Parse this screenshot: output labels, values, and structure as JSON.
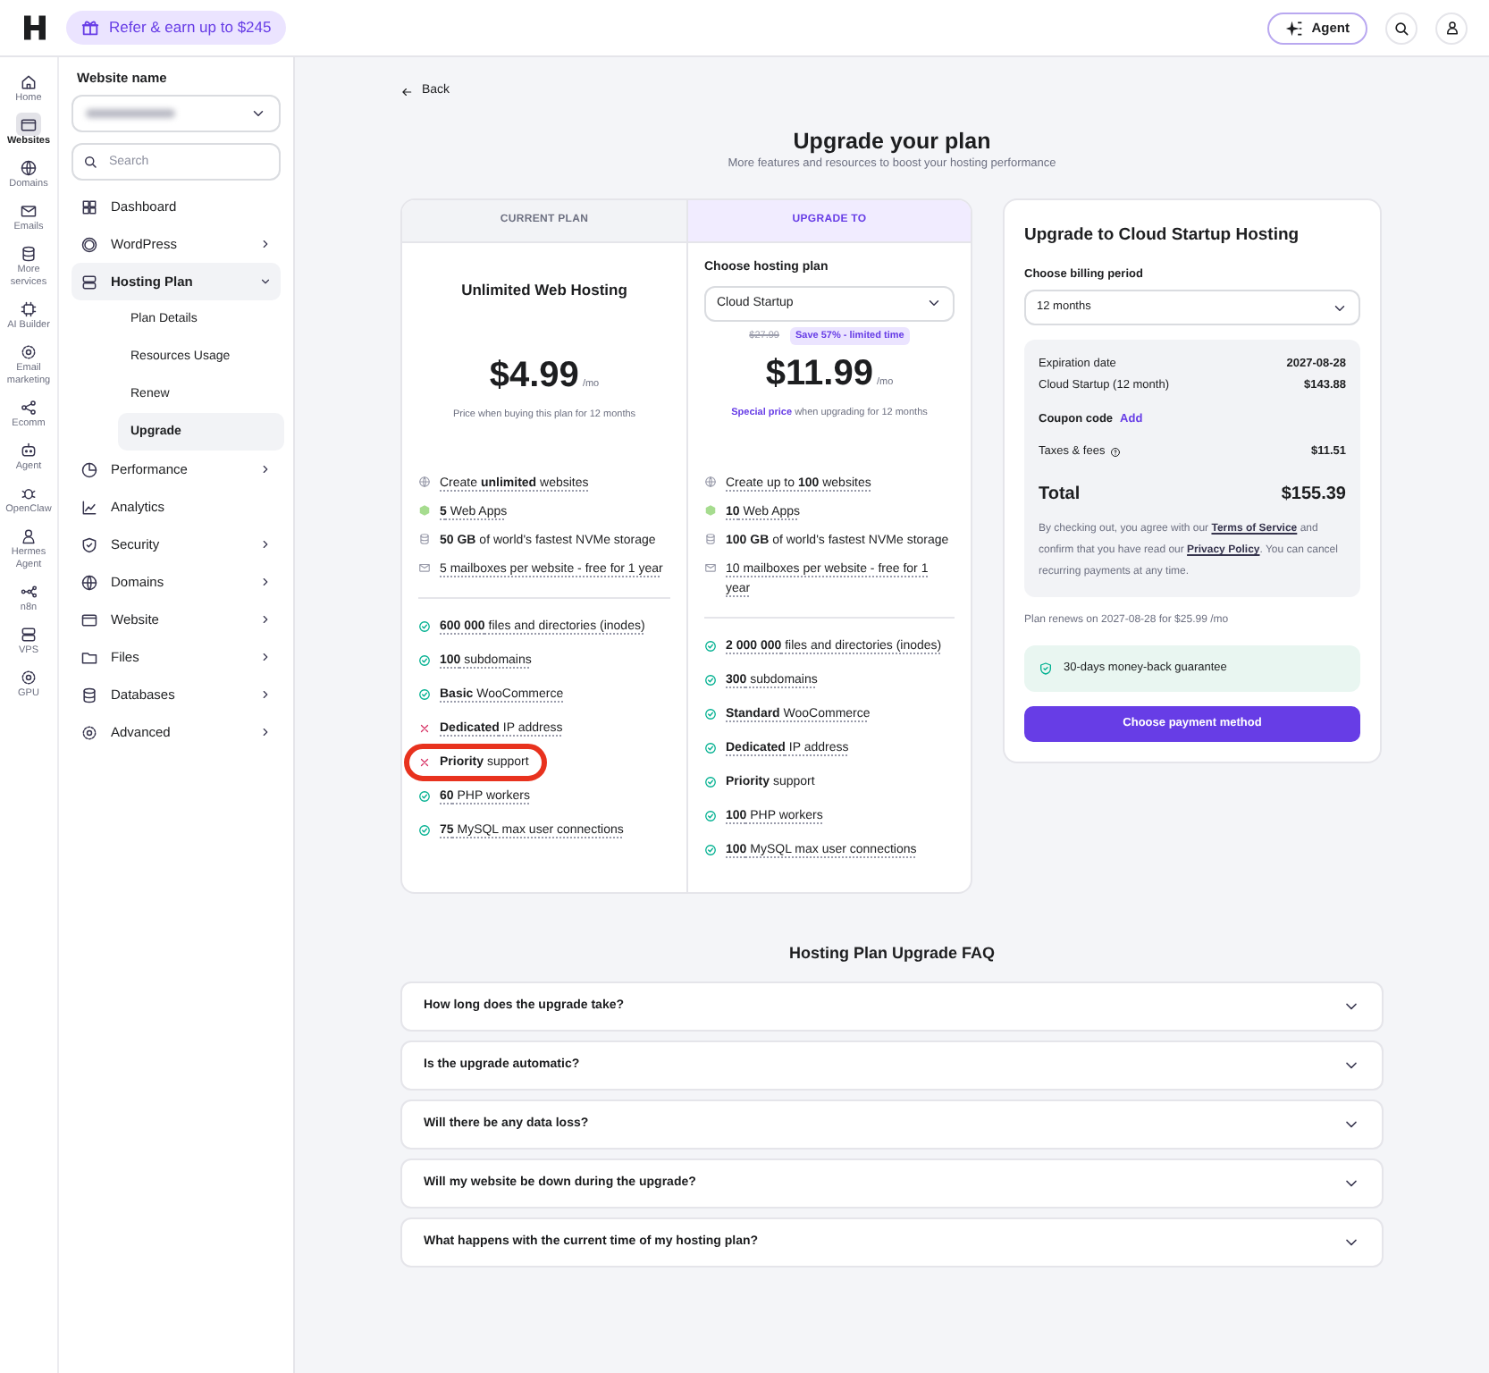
{
  "top_bar": {
    "promo": "Refer & earn up to $245",
    "agent_button": "Agent"
  },
  "rail": [
    {
      "label": "Home",
      "selected": false
    },
    {
      "label": "Websites",
      "selected": true
    },
    {
      "label": "Domains",
      "selected": false
    },
    {
      "label": "Emails",
      "selected": false
    },
    {
      "label": "More services",
      "selected": false
    },
    {
      "label": "AI Builder",
      "selected": false
    },
    {
      "label": "Email marketing",
      "selected": false
    },
    {
      "label": "Ecomm",
      "selected": false
    },
    {
      "label": "Agent",
      "selected": false
    },
    {
      "label": "OpenClaw",
      "selected": false
    },
    {
      "label": "Hermes Agent",
      "selected": false
    },
    {
      "label": "n8n",
      "selected": false
    },
    {
      "label": "VPS",
      "selected": false
    },
    {
      "label": "GPU",
      "selected": false
    }
  ],
  "nav": {
    "website_label": "Website name",
    "search_placeholder": "Search",
    "items": [
      {
        "label": "Dashboard",
        "selected": false
      },
      {
        "label": "WordPress",
        "selected": false,
        "expanded": false
      },
      {
        "label": "Hosting Plan",
        "selected": true,
        "expanded": true,
        "children": [
          {
            "label": "Plan Details",
            "selected": false
          },
          {
            "label": "Resources Usage",
            "selected": false
          },
          {
            "label": "Renew",
            "selected": false
          },
          {
            "label": "Upgrade",
            "selected": true
          }
        ]
      },
      {
        "label": "Performance",
        "selected": false,
        "expanded": false
      },
      {
        "label": "Analytics",
        "selected": false
      },
      {
        "label": "Security",
        "selected": false,
        "expanded": false
      },
      {
        "label": "Domains",
        "selected": false,
        "expanded": false
      },
      {
        "label": "Website",
        "selected": false,
        "expanded": false
      },
      {
        "label": "Files",
        "selected": false,
        "expanded": false
      },
      {
        "label": "Databases",
        "selected": false,
        "expanded": false
      },
      {
        "label": "Advanced",
        "selected": false,
        "expanded": false
      }
    ]
  },
  "back": "Back",
  "title": "Upgrade your plan",
  "subtitle": "More features and resources to boost your hosting performance",
  "current": {
    "header": "CURRENT PLAN",
    "name": "Unlimited Web Hosting",
    "price": "$4.99",
    "per": "/mo",
    "note": "Price when buying this plan for 12 months",
    "features": [
      {
        "kind": "globe",
        "text": "Create **unlimited** websites",
        "underlined": true
      },
      {
        "kind": "apps",
        "text": "**5** Web Apps",
        "underlined": true
      },
      {
        "kind": "storage",
        "text": "**50 GB** of world's fastest NVMe storage",
        "underlined": false
      },
      {
        "kind": "mail",
        "text": "5 mailboxes per website - free for 1 year",
        "underlined": true
      }
    ],
    "limits": [
      {
        "included": true,
        "text": "**600 000** files and directories (inodes)",
        "underlined": true,
        "highlighted": false
      },
      {
        "included": true,
        "text": "**100** subdomains",
        "underlined": true,
        "highlighted": false
      },
      {
        "included": true,
        "text": "**Basic** WooCommerce",
        "underlined": true,
        "highlighted": false
      },
      {
        "included": false,
        "text": "**Dedicated** IP address",
        "underlined": true,
        "highlighted": false
      },
      {
        "included": false,
        "text": "**Priority** support",
        "underlined": false,
        "highlighted": true
      },
      {
        "included": true,
        "text": "**60** PHP workers",
        "underlined": true,
        "highlighted": false
      },
      {
        "included": true,
        "text": "**75** MySQL max user connections",
        "underlined": true,
        "highlighted": false
      }
    ]
  },
  "upgrade": {
    "header": "UPGRADE TO",
    "select_label": "Choose hosting plan",
    "select_value": "Cloud Startup",
    "old_price": "$27.99",
    "discount": "Save 57% - limited time",
    "price": "$11.99",
    "per": "/mo",
    "note_highlight": "Special price",
    "note": "when upgrading for 12 months",
    "features": [
      {
        "kind": "globe",
        "text": "Create up to **100** websites",
        "underlined": true
      },
      {
        "kind": "apps",
        "text": "**10** Web Apps",
        "underlined": true
      },
      {
        "kind": "storage",
        "text": "**100 GB** of world's fastest NVMe storage",
        "underlined": false
      },
      {
        "kind": "mail",
        "text": "10 mailboxes per website - free for 1 year",
        "underlined": true
      }
    ],
    "limits": [
      {
        "included": true,
        "text": "**2 000 000** files and directories (inodes)",
        "underlined": true,
        "highlighted": false
      },
      {
        "included": true,
        "text": "**300** subdomains",
        "underlined": true,
        "highlighted": false
      },
      {
        "included": true,
        "text": "**Standard** WooCommerce",
        "underlined": true,
        "highlighted": false
      },
      {
        "included": true,
        "text": "**Dedicated** IP address",
        "underlined": true,
        "highlighted": false
      },
      {
        "included": true,
        "text": "**Priority** support",
        "underlined": false,
        "highlighted": false
      },
      {
        "included": true,
        "text": "**100** PHP workers",
        "underlined": true,
        "highlighted": false
      },
      {
        "included": true,
        "text": "**100** MySQL max user connections",
        "underlined": true,
        "highlighted": false
      }
    ]
  },
  "summary": {
    "title": "Upgrade to Cloud Startup Hosting",
    "billing_label": "Choose billing period",
    "billing_value": "12 months",
    "rows": [
      {
        "label": "Expiration date",
        "value": "2027-08-28"
      },
      {
        "label": "Cloud Startup (12 month)",
        "value": "$143.88"
      }
    ],
    "coupon_label": "Coupon code",
    "coupon_link": "Add",
    "taxes_label": "Taxes & fees",
    "taxes_value": "$11.51",
    "total_label": "Total",
    "total_value": "$155.39",
    "legal": [
      "By checking out, you agree with our ",
      "Terms of Service",
      " and confirm that you have read our ",
      "Privacy Policy",
      ". You can cancel recurring payments at any time."
    ],
    "renew": "Plan renews on 2027-08-28 for $25.99 /mo",
    "guarantee": "30-days money-back guarantee",
    "button": "Choose payment method"
  },
  "faq": {
    "title": "Hosting Plan Upgrade FAQ",
    "items": [
      {
        "question": "How long does the upgrade take?",
        "expanded": false
      },
      {
        "question": "Is the upgrade automatic?",
        "expanded": false
      },
      {
        "question": "Will there be any data loss?",
        "expanded": false
      },
      {
        "question": "Will my website be down during the upgrade?",
        "expanded": false
      },
      {
        "question": "What happens with the current time of my hosting plan?",
        "expanded": false
      }
    ]
  }
}
